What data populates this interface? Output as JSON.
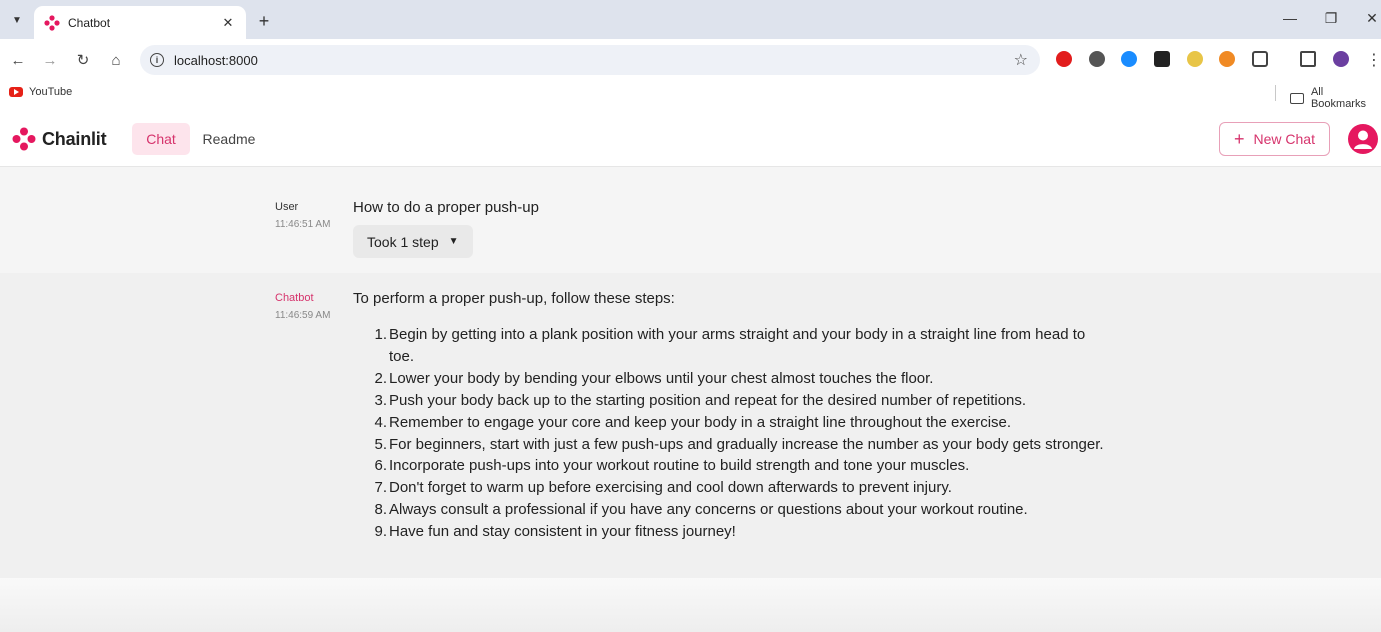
{
  "browser": {
    "tab_title": "Chatbot",
    "url": "localhost:8000",
    "bookmarks": {
      "youtube": "YouTube",
      "all": "All Bookmarks"
    }
  },
  "app": {
    "brand": "Chainlit",
    "nav": {
      "chat": "Chat",
      "readme": "Readme"
    },
    "new_chat": "New Chat",
    "accent_color": "#d6336c"
  },
  "messages": {
    "user": {
      "author": "User",
      "time": "11:46:51 AM",
      "text": "How to do a proper push-up",
      "steps_label": "Took 1 step"
    },
    "bot": {
      "author": "Chatbot",
      "time": "11:46:59 AM",
      "intro": "To perform a proper push-up, follow these steps:",
      "steps": [
        "Begin by getting into a plank position with your arms straight and your body in a straight line from head to toe.",
        "Lower your body by bending your elbows until your chest almost touches the floor.",
        "Push your body back up to the starting position and repeat for the desired number of repetitions.",
        "Remember to engage your core and keep your body in a straight line throughout the exercise.",
        "For beginners, start with just a few push-ups and gradually increase the number as your body gets stronger.",
        "Incorporate push-ups into your workout routine to build strength and tone your muscles.",
        "Don't forget to warm up before exercising and cool down afterwards to prevent injury.",
        "Always consult a professional if you have any concerns or questions about your workout routine.",
        "Have fun and stay consistent in your fitness journey!"
      ]
    }
  }
}
